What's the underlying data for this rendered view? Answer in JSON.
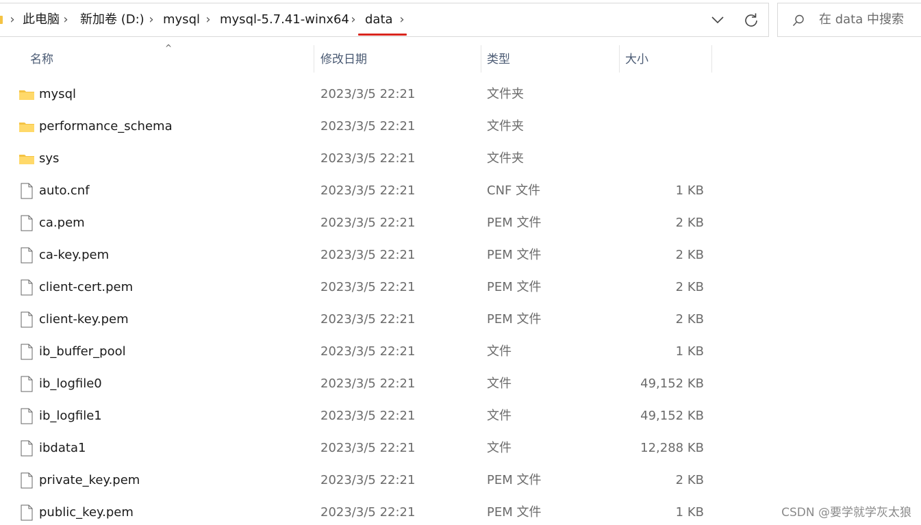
{
  "address_bar": {
    "breadcrumbs": [
      "此电脑",
      "新加卷 (D:)",
      "mysql",
      "mysql-5.7.41-winx64",
      "data"
    ],
    "separator": "›",
    "accent_color": "#d9251d"
  },
  "search": {
    "placeholder": "在 data 中搜索"
  },
  "columns": {
    "name": "名称",
    "modified": "修改日期",
    "type": "类型",
    "size": "大小"
  },
  "sort_indicator": "^",
  "files": [
    {
      "name": "mysql",
      "modified": "2023/3/5 22:21",
      "type": "文件夹",
      "size": "",
      "icon": "folder-icon"
    },
    {
      "name": "performance_schema",
      "modified": "2023/3/5 22:21",
      "type": "文件夹",
      "size": "",
      "icon": "folder-icon"
    },
    {
      "name": "sys",
      "modified": "2023/3/5 22:21",
      "type": "文件夹",
      "size": "",
      "icon": "folder-icon"
    },
    {
      "name": "auto.cnf",
      "modified": "2023/3/5 22:21",
      "type": "CNF 文件",
      "size": "1 KB",
      "icon": "file-icon"
    },
    {
      "name": "ca.pem",
      "modified": "2023/3/5 22:21",
      "type": "PEM 文件",
      "size": "2 KB",
      "icon": "file-icon"
    },
    {
      "name": "ca-key.pem",
      "modified": "2023/3/5 22:21",
      "type": "PEM 文件",
      "size": "2 KB",
      "icon": "file-icon"
    },
    {
      "name": "client-cert.pem",
      "modified": "2023/3/5 22:21",
      "type": "PEM 文件",
      "size": "2 KB",
      "icon": "file-icon"
    },
    {
      "name": "client-key.pem",
      "modified": "2023/3/5 22:21",
      "type": "PEM 文件",
      "size": "2 KB",
      "icon": "file-icon"
    },
    {
      "name": "ib_buffer_pool",
      "modified": "2023/3/5 22:21",
      "type": "文件",
      "size": "1 KB",
      "icon": "file-icon"
    },
    {
      "name": "ib_logfile0",
      "modified": "2023/3/5 22:21",
      "type": "文件",
      "size": "49,152 KB",
      "icon": "file-icon"
    },
    {
      "name": "ib_logfile1",
      "modified": "2023/3/5 22:21",
      "type": "文件",
      "size": "49,152 KB",
      "icon": "file-icon"
    },
    {
      "name": "ibdata1",
      "modified": "2023/3/5 22:21",
      "type": "文件",
      "size": "12,288 KB",
      "icon": "file-icon"
    },
    {
      "name": "private_key.pem",
      "modified": "2023/3/5 22:21",
      "type": "PEM 文件",
      "size": "2 KB",
      "icon": "file-icon"
    },
    {
      "name": "public_key.pem",
      "modified": "2023/3/5 22:21",
      "type": "PEM 文件",
      "size": "1 KB",
      "icon": "file-icon"
    }
  ],
  "watermark": "CSDN @要学就学灰太狼"
}
